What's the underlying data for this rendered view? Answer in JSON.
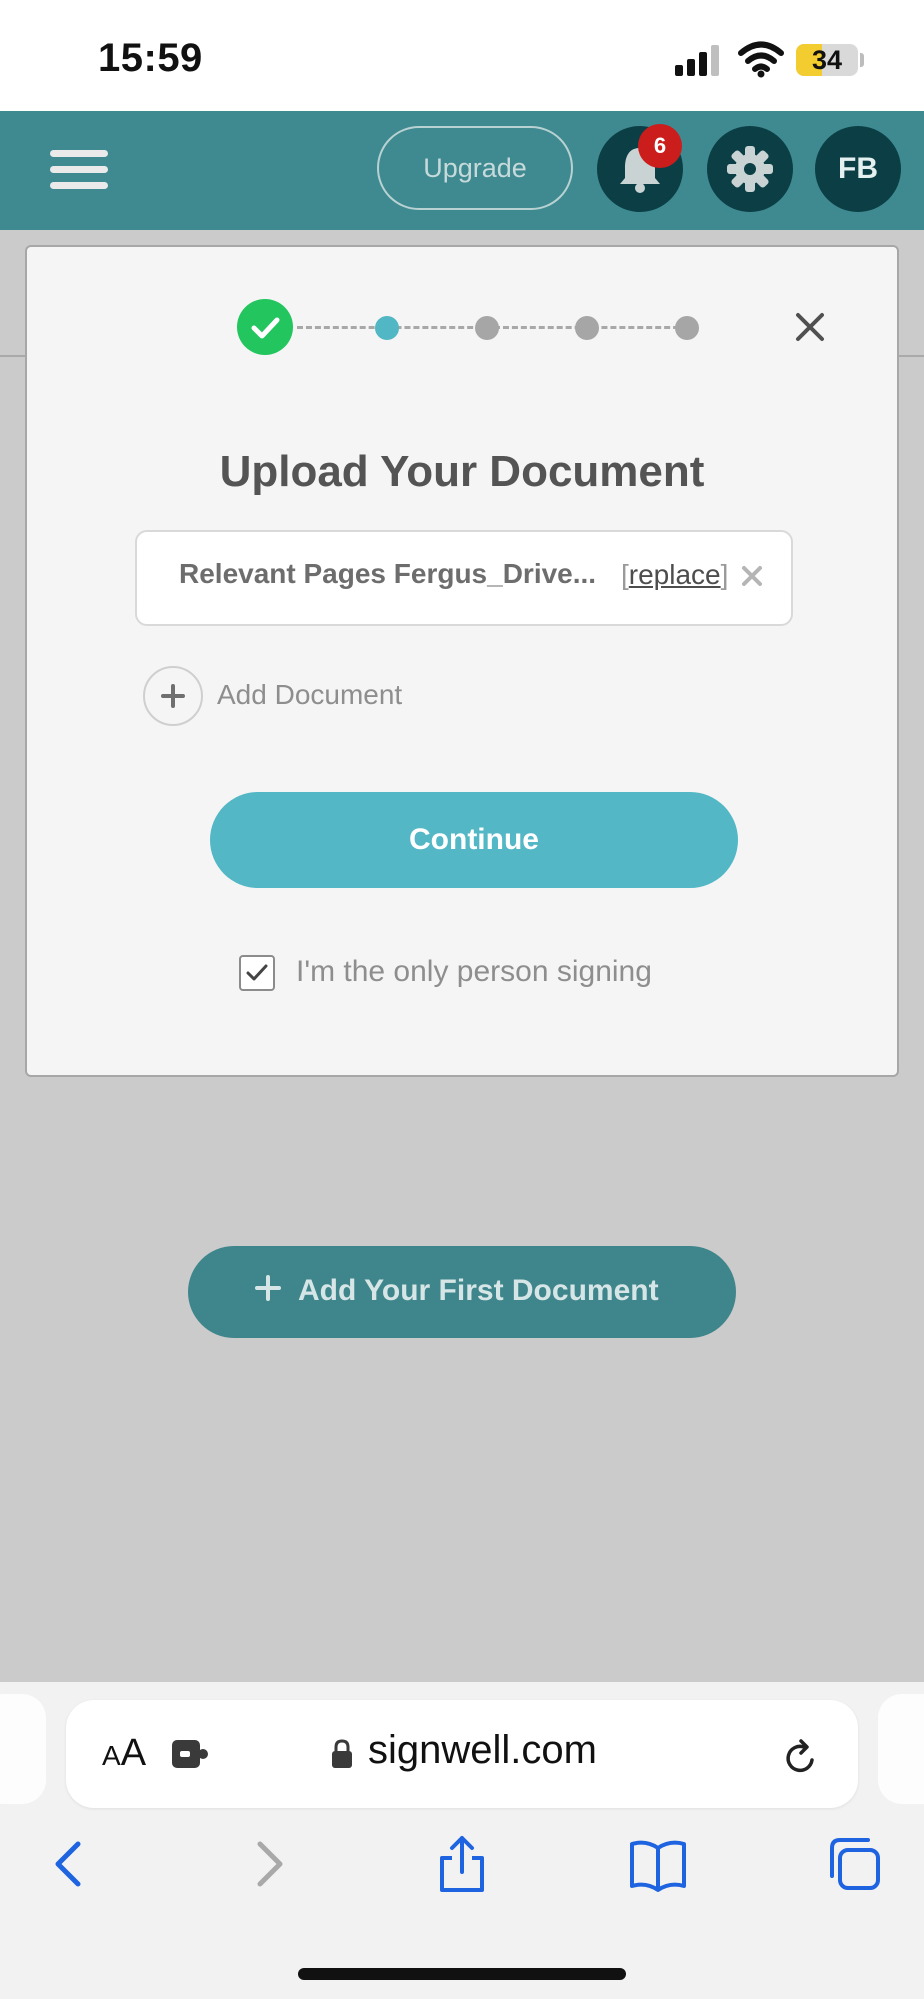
{
  "status_bar": {
    "time": "15:59",
    "battery_percent": "34",
    "battery_level": 0.34
  },
  "app_header": {
    "menu_icon": "hamburger-icon",
    "upgrade_label": "Upgrade",
    "notification_count": "6",
    "settings_icon": "gear-icon",
    "avatar_initials": "FB",
    "bar_color": "#3e8a90"
  },
  "upload_modal": {
    "stepper": {
      "total_steps": 5,
      "completed_steps": 1,
      "current_step": 2,
      "completed_color": "#22c55e",
      "active_color": "#51b7c4",
      "pending_color": "#a6a6a6"
    },
    "title": "Upload Your Document",
    "uploaded_file": {
      "name": "Relevant Pages Fergus_Drive...",
      "replace_link": "replace",
      "bracket_open": "[",
      "bracket_close": "]"
    },
    "add_document_label": "Add Document",
    "continue_label": "Continue",
    "only_signer": {
      "label": "I'm the only person signing",
      "checked": true
    },
    "close_icon": "close-icon"
  },
  "background": {
    "add_first_document_label": "Add Your First Document"
  },
  "browser": {
    "text_size_label": "AA",
    "url": "signwell.com",
    "toolbar": [
      "back-icon",
      "forward-icon",
      "share-icon",
      "bookmarks-icon",
      "tabs-icon"
    ],
    "accent_color": "#1e63e0"
  }
}
